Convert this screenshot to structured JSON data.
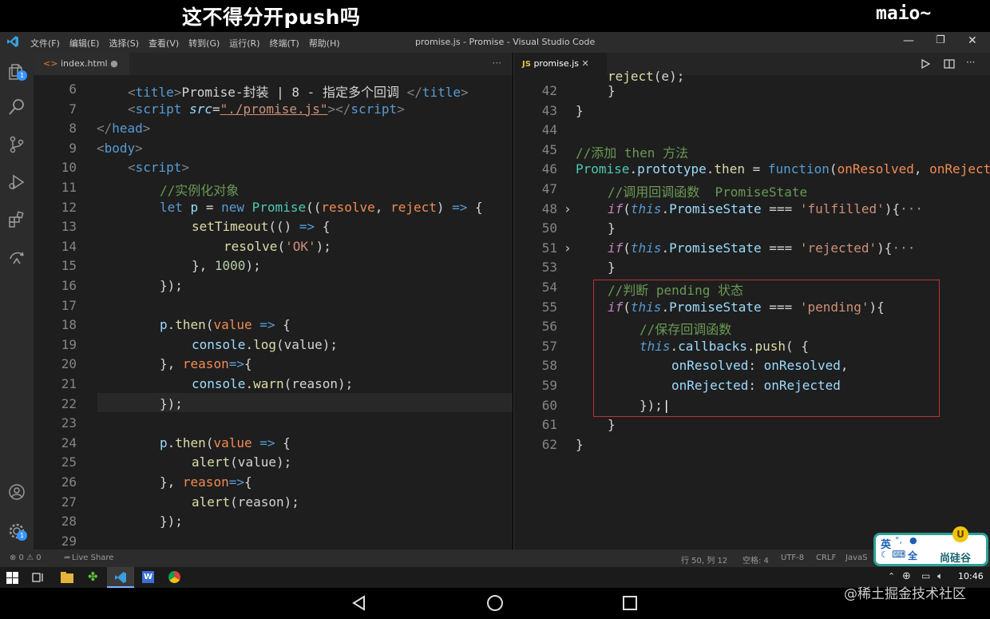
{
  "caption": "这不得分开push吗",
  "user_label": "maio~",
  "titlebar": {
    "menu": [
      "文件(F)",
      "编辑(E)",
      "选择(S)",
      "查看(V)",
      "转到(G)",
      "运行(R)",
      "终端(T)",
      "帮助(H)"
    ],
    "window_title": "promise.js - Promise - Visual Studio Code"
  },
  "left_tab": {
    "name": "index.html"
  },
  "right_tab": {
    "name": "promise.js",
    "lang": "JS"
  },
  "left_lines": [
    "6",
    "7",
    "8",
    "9",
    "10",
    "11",
    "12",
    "13",
    "14",
    "15",
    "16",
    "17",
    "18",
    "19",
    "20",
    "21",
    "22",
    "23",
    "24",
    "25",
    "26",
    "27",
    "28",
    "29"
  ],
  "right_lines": [
    "42",
    "43",
    "44",
    "45",
    "46",
    "47",
    "48",
    "50",
    "51",
    "53",
    "54",
    "55",
    "56",
    "57",
    "58",
    "59",
    "60",
    "61",
    "62"
  ],
  "code_strings": {
    "title_text": "Promise-封装 | 8 - 指定多个回调 ",
    "script_src": "\"./promise.js\"",
    "cm_instance": "//实例化对象",
    "ok": "'OK'",
    "timeout": "1000",
    "cm_then": "//添加 then 方法",
    "cm_call": "//调用回调函数  PromiseState",
    "fulfilled": "'fulfilled'",
    "rejected": "'rejected'",
    "cm_pending": "//判断 pending 状态",
    "pending": "'pending'",
    "cm_save": "//保存回调函数"
  },
  "status": {
    "problems": "⊗ 0 ⚠ 0",
    "liveshare": "Live Share",
    "position": "行 50, 列 12",
    "spaces": "空格: 4",
    "encoding": "UTF-8",
    "eol": "CRLF",
    "lang": "JavaS"
  },
  "taskbar": {
    "time": "10:46"
  },
  "ime": {
    "lang": "英",
    "mode": "全",
    "brand": "尚硅谷"
  },
  "watermark": "@稀土掘金技术社区",
  "colors": {
    "accent": "#007acc",
    "highlight_box": "#bb3333",
    "editor_bg": "#1e1e1e"
  }
}
